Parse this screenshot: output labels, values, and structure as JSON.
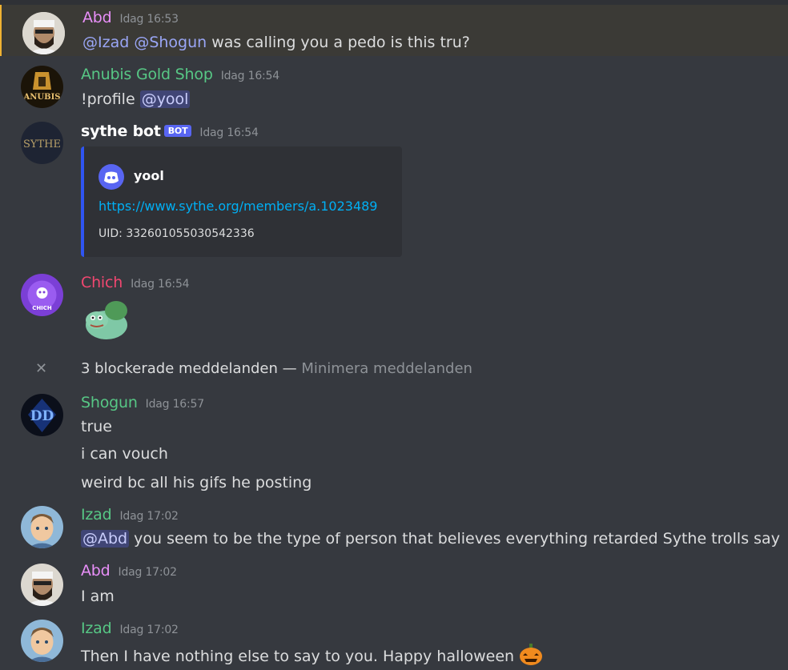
{
  "messages": [
    {
      "author": "Abd",
      "color": "#e88ff8",
      "time": "Idag 16:53",
      "lines": [
        {
          "mentions": [
            "@Izad",
            "@Shogun"
          ],
          "text": " was calling you a pedo is this tru?"
        }
      ]
    },
    {
      "author": "Anubis Gold Shop",
      "color": "#57c785",
      "time": "Idag 16:54",
      "cmd": "!profile",
      "mention": "@yool"
    },
    {
      "author": "sythe bot",
      "color": "#ffffff",
      "badge": "BOT",
      "time": "Idag 16:54",
      "embed": {
        "title": "yool",
        "url": "https://www.sythe.org/members/a.1023489",
        "uid": "UID: 332601055030542336"
      }
    },
    {
      "author": "Chich",
      "color": "#f04770",
      "time": "Idag 16:54"
    },
    {
      "author": "Shogun",
      "color": "#57c785",
      "time": "Idag 16:57",
      "lines": [
        "true",
        "i can vouch",
        "weird bc all his gifs he posting"
      ]
    },
    {
      "author": "Izad",
      "color": "#57c785",
      "time": "Idag 17:02",
      "mention": "@Abd",
      "text": " you seem to be the type of person that believes everything retarded Sythe trolls say"
    },
    {
      "author": "Abd",
      "color": "#e88ff8",
      "time": "Idag 17:02",
      "text": "I am"
    },
    {
      "author": "Izad",
      "color": "#57c785",
      "time": "Idag 17:02",
      "text": "Then I have nothing else to say to you. Happy halloween"
    }
  ],
  "blocked": {
    "text": "3 blockerade meddelanden —",
    "action": "Minimera meddelanden",
    "close_icon": "✕"
  },
  "avatars": {
    "abd": "bearded man avatar",
    "anubis": "ANUBIS logo",
    "sythe": "SYTHE logo",
    "chich": "purple pirate skull",
    "shogun": "DD blue logo",
    "izad": "cartoon avatar"
  }
}
